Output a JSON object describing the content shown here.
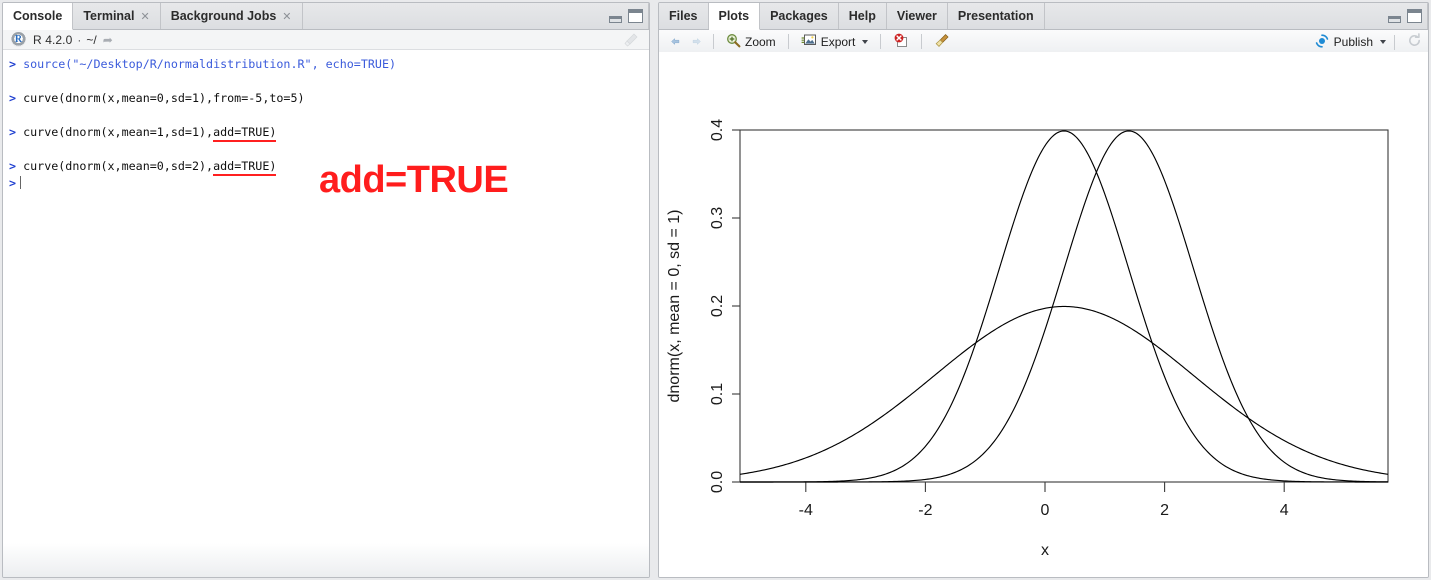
{
  "console": {
    "tabs": [
      {
        "label": "Console",
        "active": true,
        "closable": false
      },
      {
        "label": "Terminal",
        "active": false,
        "closable": true
      },
      {
        "label": "Background Jobs",
        "active": false,
        "closable": true
      }
    ],
    "info": {
      "version": "R 4.2.0",
      "separator": "·",
      "path": "~/",
      "logo": "r-logo-icon",
      "broom": "broom-icon"
    },
    "lines": [
      {
        "prompt": "> ",
        "text": "source(\"~/Desktop/R/normaldistribution.R\", echo=TRUE)",
        "style": "source"
      },
      {
        "prompt": "> ",
        "text": "curve(dnorm(x,mean=0,sd=1),from=-5,to=5)",
        "style": "plain"
      },
      {
        "prompt": "> ",
        "text": "curve(dnorm(x,mean=1,sd=1),",
        "underlined": "add=TRUE)",
        "style": "plain"
      },
      {
        "prompt": "> ",
        "text": "curve(dnorm(x,mean=0,sd=2),",
        "underlined": "add=TRUE)",
        "style": "plain"
      }
    ],
    "current_prompt": ">",
    "annotation": "add=TRUE",
    "annotation_color": "#ff1d1d"
  },
  "plots": {
    "tabs": [
      {
        "label": "Files",
        "active": false
      },
      {
        "label": "Plots",
        "active": true
      },
      {
        "label": "Packages",
        "active": false
      },
      {
        "label": "Help",
        "active": false
      },
      {
        "label": "Viewer",
        "active": false
      },
      {
        "label": "Presentation",
        "active": false
      }
    ],
    "toolbar": {
      "back": "back-arrow-icon",
      "forward": "forward-arrow-icon",
      "zoom_label": "Zoom",
      "zoom_icon": "magnifier-plus-icon",
      "export_label": "Export",
      "export_icon": "export-image-icon",
      "remove_plot_icon": "remove-plot-icon",
      "clear_all_icon": "broom-icon",
      "publish_label": "Publish",
      "publish_icon": "publish-icon",
      "refresh_icon": "refresh-icon"
    }
  },
  "chart_data": {
    "type": "line",
    "title": "",
    "xlabel": "x",
    "ylabel": "dnorm(x, mean = 0, sd = 1)",
    "xlim": [
      -5,
      5
    ],
    "ylim": [
      0.0,
      0.4
    ],
    "xticks": [
      "-4",
      "-2",
      "0",
      "2",
      "4"
    ],
    "xtick_values": [
      -4,
      -2,
      0,
      2,
      4
    ],
    "yticks": [
      "0.0",
      "0.1",
      "0.2",
      "0.3",
      "0.4"
    ],
    "ytick_values": [
      0.0,
      0.1,
      0.2,
      0.3,
      0.4
    ],
    "grid": false,
    "legend": "none",
    "box": true,
    "series": [
      {
        "name": "dnorm(x, mean = 0, sd = 1)",
        "mean": 0,
        "sd": 1,
        "peak": 0.3989,
        "color": "#000000"
      },
      {
        "name": "dnorm(x, mean = 1, sd = 1)",
        "mean": 1,
        "sd": 1,
        "peak": 0.3989,
        "color": "#000000"
      },
      {
        "name": "dnorm(x, mean = 0, sd = 2)",
        "mean": 0,
        "sd": 2,
        "peak": 0.1995,
        "color": "#000000"
      }
    ]
  }
}
